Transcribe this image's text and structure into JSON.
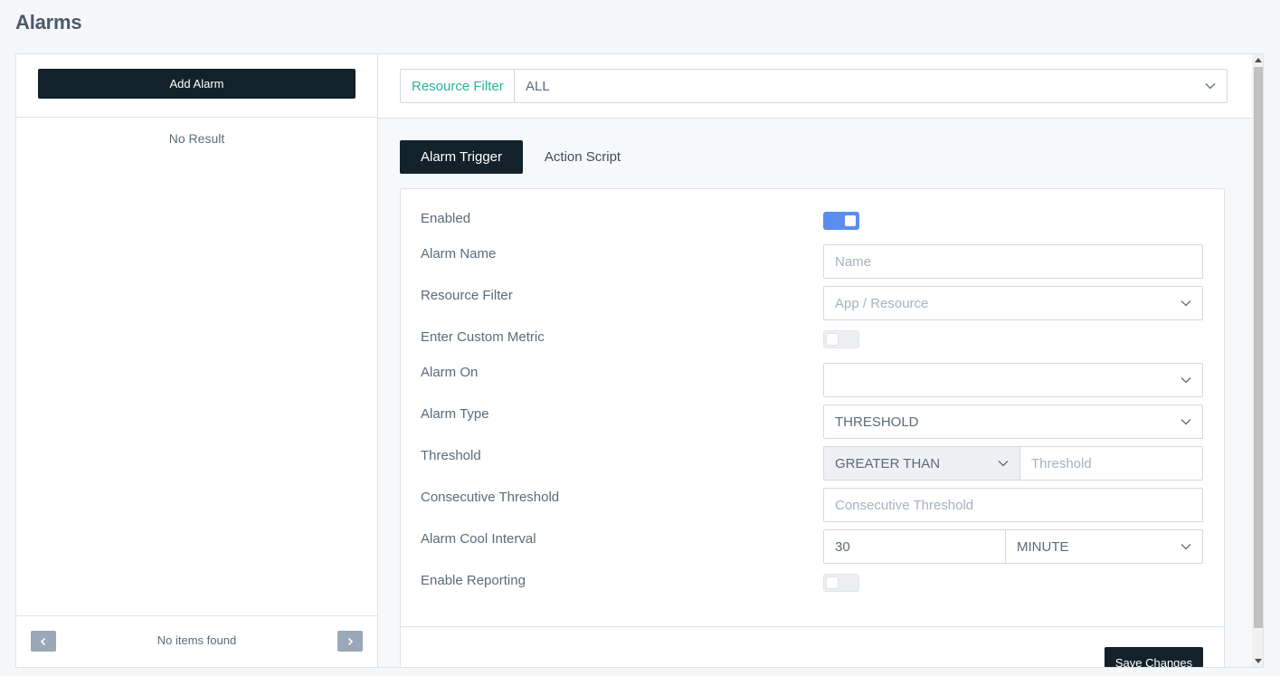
{
  "page": {
    "title": "Alarms"
  },
  "sidebar": {
    "add_button": "Add Alarm",
    "empty_text": "No Result",
    "pagination": {
      "status": "No items found"
    }
  },
  "filter": {
    "label": "Resource Filter",
    "value": "ALL"
  },
  "tabs": [
    {
      "label": "Alarm Trigger",
      "active": true
    },
    {
      "label": "Action Script",
      "active": false
    }
  ],
  "form": {
    "enabled": {
      "label": "Enabled",
      "value": true
    },
    "alarm_name": {
      "label": "Alarm Name",
      "placeholder": "Name",
      "value": ""
    },
    "resource_filter": {
      "label": "Resource Filter",
      "placeholder": "App / Resource"
    },
    "custom_metric": {
      "label": "Enter Custom Metric",
      "value": false
    },
    "alarm_on": {
      "label": "Alarm On",
      "value": ""
    },
    "alarm_type": {
      "label": "Alarm Type",
      "value": "THRESHOLD"
    },
    "threshold": {
      "label": "Threshold",
      "operator": "GREATER THAN",
      "placeholder": "Threshold"
    },
    "consecutive": {
      "label": "Consecutive Threshold",
      "placeholder": "Consecutive Threshold"
    },
    "cool_interval": {
      "label": "Alarm Cool Interval",
      "value": "30",
      "unit": "MINUTE"
    },
    "reporting": {
      "label": "Enable Reporting",
      "value": false
    },
    "save_button": "Save Changes"
  },
  "colors": {
    "accent": "#2bb398",
    "dark": "#13212b",
    "toggle_on": "#5b8def"
  }
}
